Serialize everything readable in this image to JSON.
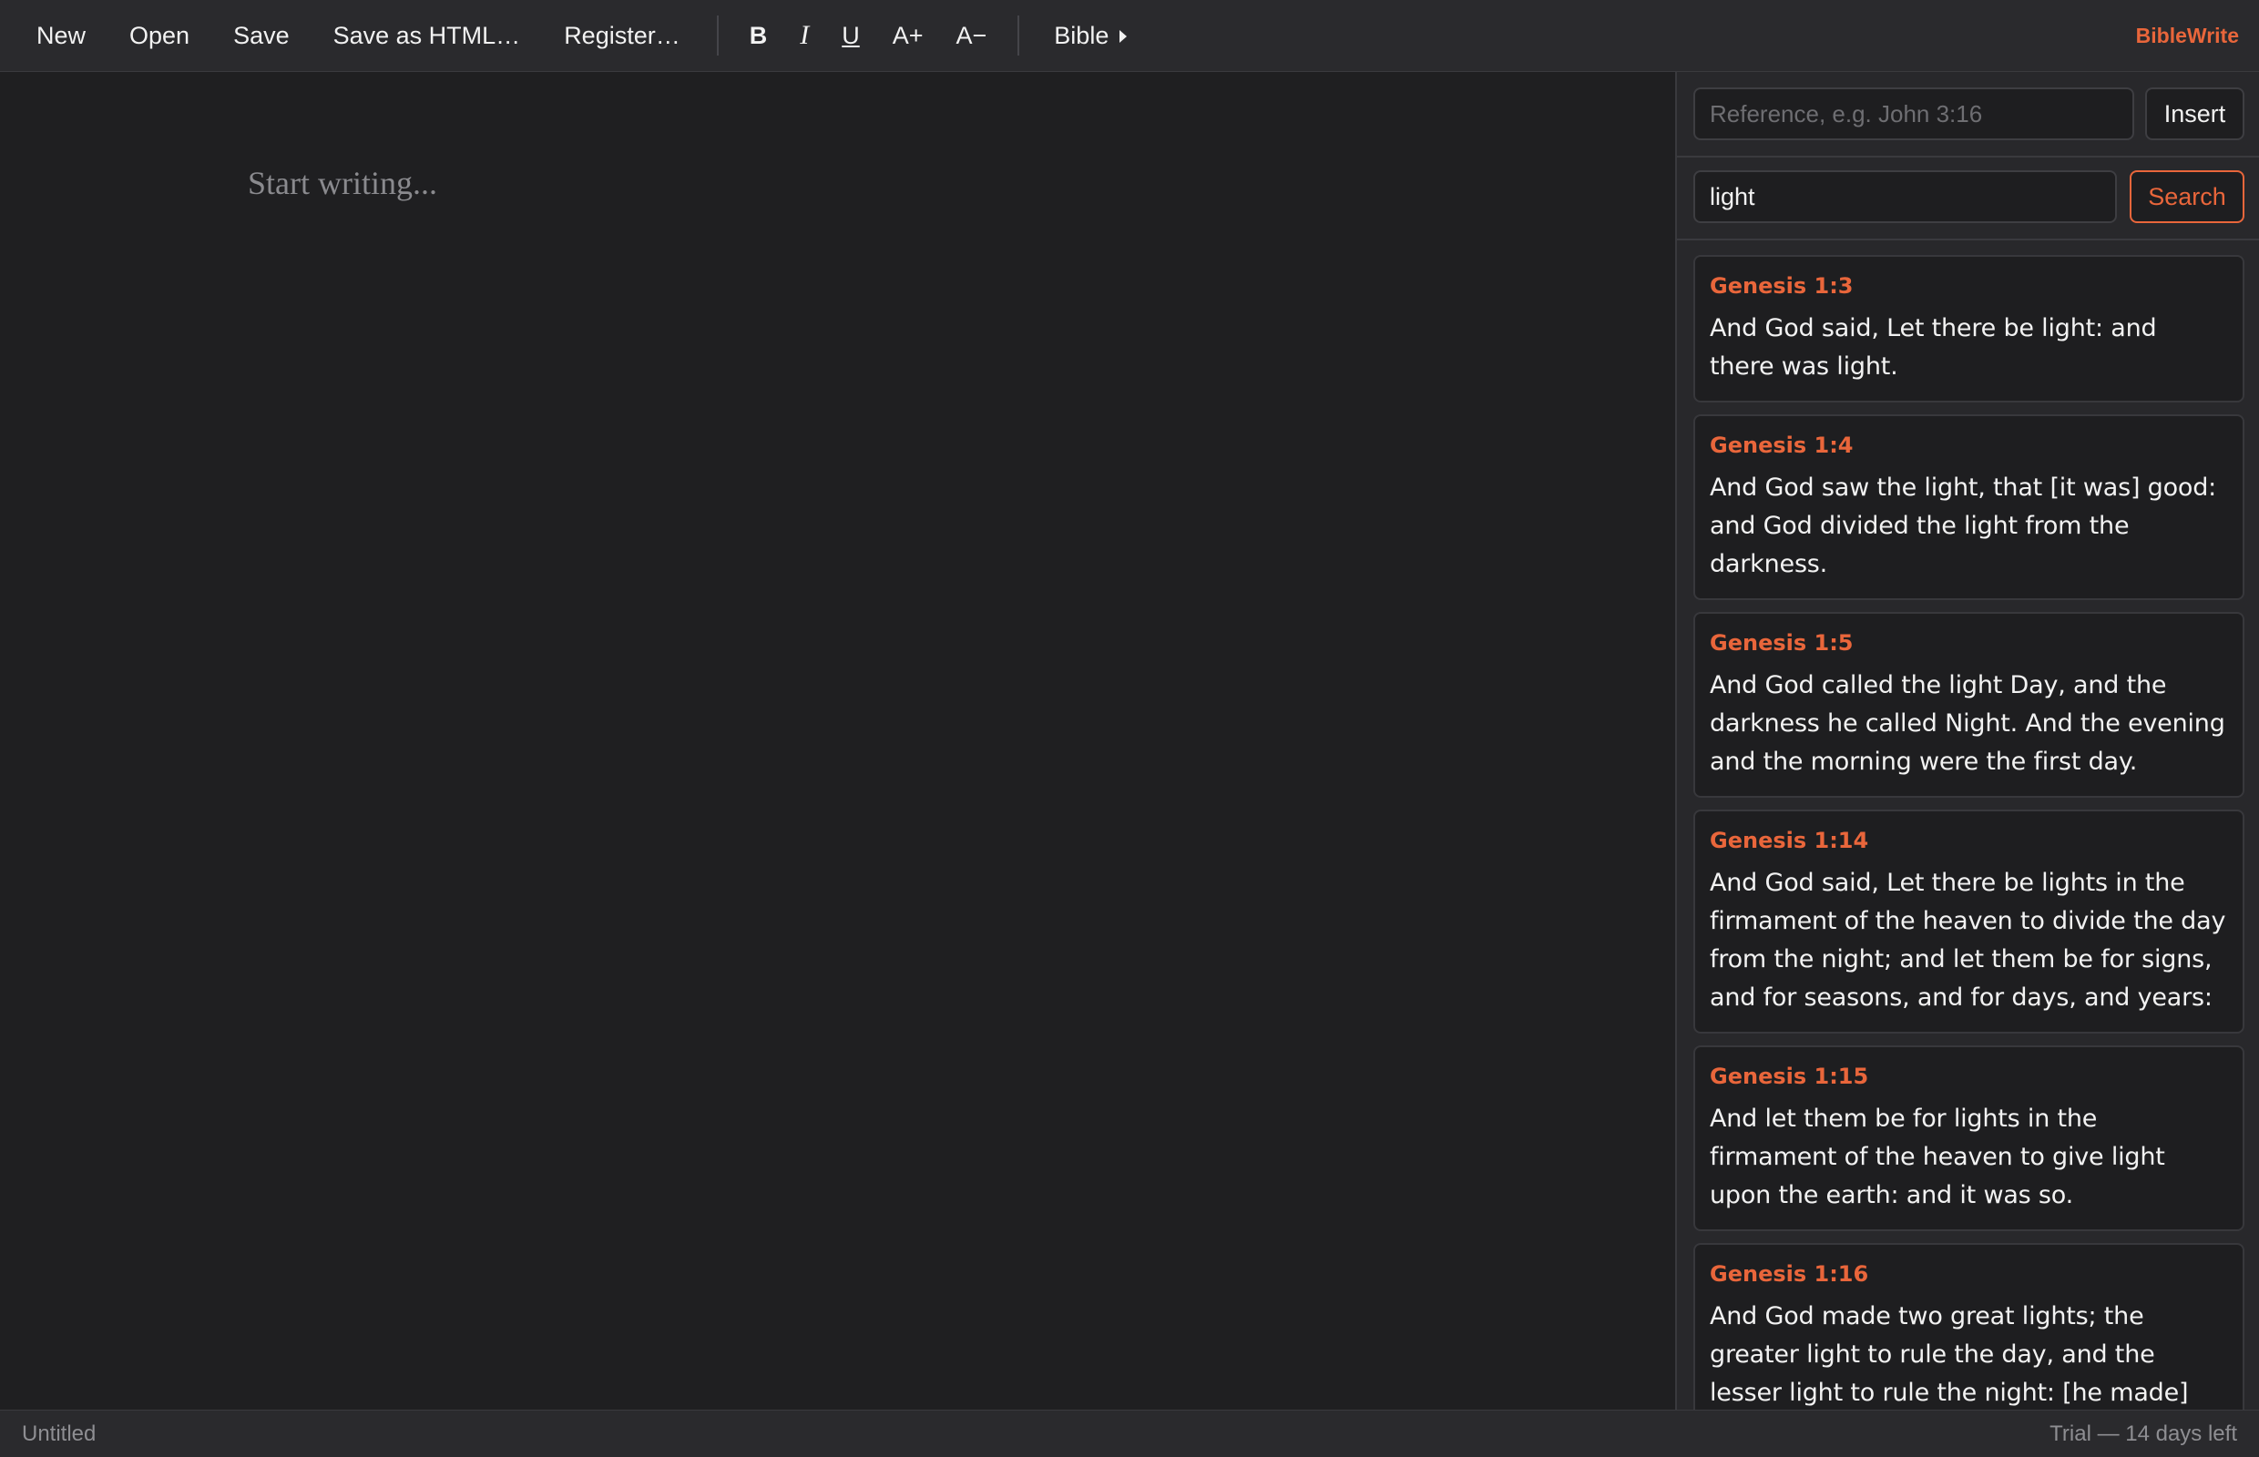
{
  "toolbar": {
    "menu": [
      "New",
      "Open",
      "Save",
      "Save as HTML…",
      "Register…"
    ],
    "format": {
      "bold": "B",
      "italic": "I",
      "underline": "U",
      "font_increase": "A+",
      "font_decrease": "A−"
    },
    "bible_menu": "Bible",
    "brand": "BibleWrite"
  },
  "editor": {
    "placeholder": "Start writing..."
  },
  "sidebar": {
    "reference": {
      "placeholder": "Reference, e.g. John 3:16",
      "value": "",
      "insert_label": "Insert"
    },
    "search": {
      "value": "light",
      "button_label": "Search"
    },
    "results": [
      {
        "ref": "Genesis 1:3",
        "text": "And God said, Let there be light: and there was light."
      },
      {
        "ref": "Genesis 1:4",
        "text": "And God saw the light, that [it was] good: and God divided the light from the darkness."
      },
      {
        "ref": "Genesis 1:5",
        "text": "And God called the light Day, and the darkness he called Night. And the evening and the morning were the first day."
      },
      {
        "ref": "Genesis 1:14",
        "text": "And God said, Let there be lights in the firmament of the heaven to divide the day from the night; and let them be for signs, and for seasons, and for days, and years:"
      },
      {
        "ref": "Genesis 1:15",
        "text": "And let them be for lights in the firmament of the heaven to give light upon the earth: and it was so."
      },
      {
        "ref": "Genesis 1:16",
        "text": "And God made two great lights; the greater light to rule the day, and the lesser light to rule the night: [he made] the stars also."
      }
    ]
  },
  "status": {
    "document": "Untitled",
    "license": "Trial — 14 days left"
  },
  "colors": {
    "accent": "#e9663b",
    "background": "#1f1f21",
    "toolbar": "#2a2a2d"
  }
}
